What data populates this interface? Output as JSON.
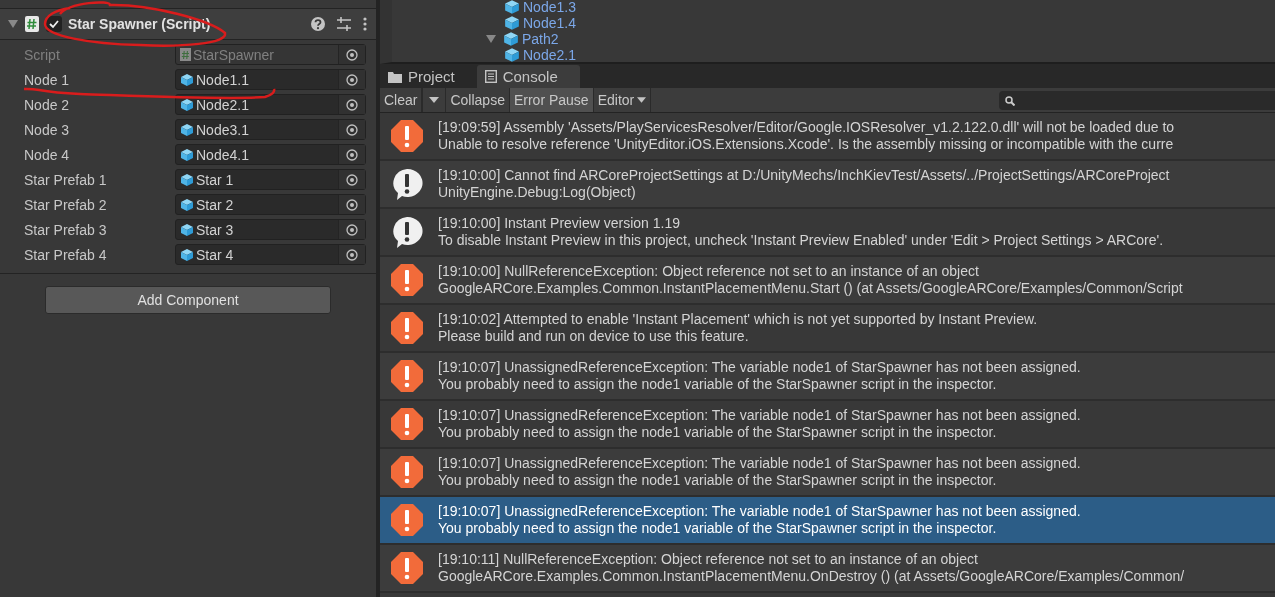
{
  "inspector": {
    "component": {
      "title": "Star Spawner (Script)",
      "expanded": true,
      "enabled": true
    },
    "fields": [
      {
        "label": "Script",
        "value": "StarSpawner",
        "kind": "script",
        "disabled": true
      },
      {
        "label": "Node 1",
        "value": "Node1.1",
        "kind": "object",
        "disabled": false
      },
      {
        "label": "Node 2",
        "value": "Node2.1",
        "kind": "object",
        "disabled": false
      },
      {
        "label": "Node 3",
        "value": "Node3.1",
        "kind": "object",
        "disabled": false
      },
      {
        "label": "Node 4",
        "value": "Node4.1",
        "kind": "object",
        "disabled": false
      },
      {
        "label": "Star Prefab 1",
        "value": "Star 1",
        "kind": "object",
        "disabled": false
      },
      {
        "label": "Star Prefab 2",
        "value": "Star 2",
        "kind": "object",
        "disabled": false
      },
      {
        "label": "Star Prefab 3",
        "value": "Star 3",
        "kind": "object",
        "disabled": false
      },
      {
        "label": "Star Prefab 4",
        "value": "Star 4",
        "kind": "object",
        "disabled": false
      }
    ],
    "add_button": "Add Component"
  },
  "hierarchy": {
    "items": [
      {
        "label": "Node1.3"
      },
      {
        "label": "Node1.4"
      },
      {
        "label": "Path2",
        "expanded": true,
        "children": [
          {
            "label": "Node2.1"
          }
        ]
      }
    ]
  },
  "tabs": [
    {
      "label": "Project",
      "kind": "folder",
      "selected": false
    },
    {
      "label": "Console",
      "kind": "console",
      "selected": true
    }
  ],
  "toolbar": [
    {
      "label": "Clear",
      "kind": "split",
      "on": false
    },
    {
      "label": "Collapse",
      "kind": "toggle",
      "on": false
    },
    {
      "label": "Error Pause",
      "kind": "toggle",
      "on": true
    },
    {
      "label": "Editor",
      "kind": "dropdown",
      "on": false
    }
  ],
  "console": {
    "entries": [
      {
        "kind": "error",
        "selected": false,
        "line1": "[19:09:59] Assembly 'Assets/PlayServicesResolver/Editor/Google.IOSResolver_v1.2.122.0.dll' will not be loaded due to",
        "line2": "Unable to resolve reference 'UnityEditor.iOS.Extensions.Xcode'. Is the assembly missing or incompatible with the curre"
      },
      {
        "kind": "info",
        "selected": false,
        "line1": "[19:10:00] Cannot find ARCoreProjectSettings at D:/UnityMechs/InchKievTest/Assets/../ProjectSettings/ARCoreProject",
        "line2": "UnityEngine.Debug:Log(Object)"
      },
      {
        "kind": "info",
        "selected": false,
        "line1": "[19:10:00] Instant Preview version 1.19",
        "line2": "To disable Instant Preview in this project, uncheck 'Instant Preview Enabled' under 'Edit > Project Settings > ARCore'."
      },
      {
        "kind": "error",
        "selected": false,
        "line1": "[19:10:00] NullReferenceException: Object reference not set to an instance of an object",
        "line2": "GoogleARCore.Examples.Common.InstantPlacementMenu.Start () (at Assets/GoogleARCore/Examples/Common/Script"
      },
      {
        "kind": "error",
        "selected": false,
        "line1": "[19:10:02] Attempted to enable 'Instant Placement' which is not yet supported by Instant Preview.",
        "line2": "Please build and run on device to use this feature."
      },
      {
        "kind": "error",
        "selected": false,
        "line1": "[19:10:07] UnassignedReferenceException: The variable node1 of StarSpawner has not been assigned.",
        "line2": "You probably need to assign the node1 variable of the StarSpawner script in the inspector."
      },
      {
        "kind": "error",
        "selected": false,
        "line1": "[19:10:07] UnassignedReferenceException: The variable node1 of StarSpawner has not been assigned.",
        "line2": "You probably need to assign the node1 variable of the StarSpawner script in the inspector."
      },
      {
        "kind": "error",
        "selected": false,
        "line1": "[19:10:07] UnassignedReferenceException: The variable node1 of StarSpawner has not been assigned.",
        "line2": "You probably need to assign the node1 variable of the StarSpawner script in the inspector."
      },
      {
        "kind": "error",
        "selected": true,
        "line1": "[19:10:07] UnassignedReferenceException: The variable node1 of StarSpawner has not been assigned.",
        "line2": "You probably need to assign the node1 variable of the StarSpawner script in the inspector."
      },
      {
        "kind": "error",
        "selected": false,
        "line1": "[19:10:11] NullReferenceException: Object reference not set to an instance of an object",
        "line2": "GoogleARCore.Examples.Common.InstantPlacementMenu.OnDestroy () (at Assets/GoogleARCore/Examples/Common/"
      }
    ]
  }
}
